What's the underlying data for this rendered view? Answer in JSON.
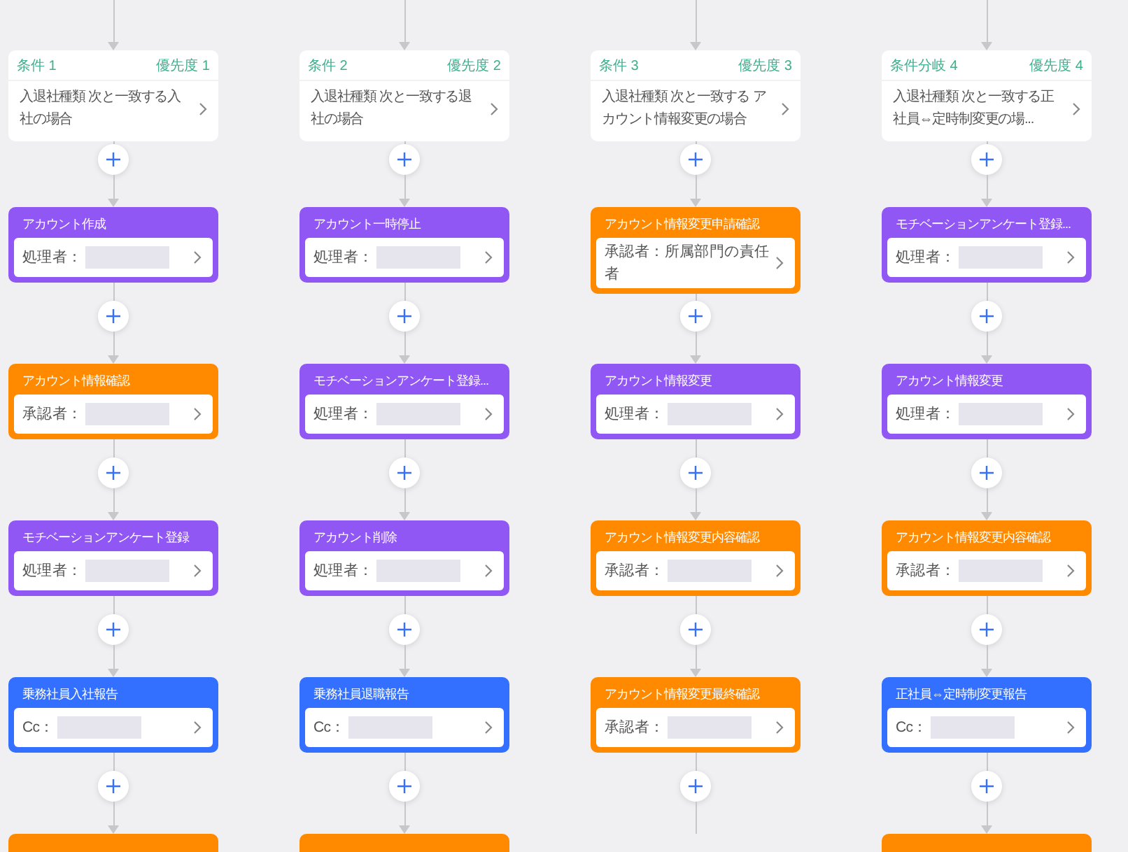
{
  "columns": [
    {
      "condition": {
        "label": "条件 1",
        "priority": "優先度 1",
        "text": "入退社種類 次と一致する入社の場合"
      },
      "steps": [
        {
          "kind": "process",
          "title": "アカウント作成",
          "role": "処理者：",
          "redacted": true
        },
        {
          "kind": "approval",
          "title": "アカウント情報確認",
          "role": "承認者：",
          "redacted": true
        },
        {
          "kind": "process",
          "title": "モチベーションアンケート登録",
          "role": "処理者：",
          "redacted": true
        },
        {
          "kind": "cc",
          "title": "乗務社員入社報告",
          "role": "Cc：",
          "redacted": true
        },
        {
          "kind": "approval"
        }
      ]
    },
    {
      "condition": {
        "label": "条件 2",
        "priority": "優先度 2",
        "text": "入退社種類 次と一致する退社の場合"
      },
      "steps": [
        {
          "kind": "process",
          "title": "アカウント一時停止",
          "role": "処理者：",
          "redacted": true
        },
        {
          "kind": "process",
          "title": "モチベーションアンケート登録...",
          "role": "処理者：",
          "redacted": true
        },
        {
          "kind": "process",
          "title": "アカウント削除",
          "role": "処理者：",
          "redacted": true
        },
        {
          "kind": "cc",
          "title": "乗務社員退職報告",
          "role": "Cc：",
          "redacted": true
        },
        {
          "kind": "approval"
        }
      ]
    },
    {
      "condition": {
        "label": "条件 3",
        "priority": "優先度 3",
        "text": "入退社種類 次と一致する アカウント情報変更の場合"
      },
      "steps": [
        {
          "kind": "approval",
          "title": "アカウント情報変更申請確認",
          "role": "承認者：所属部門の責任者",
          "redacted": false
        },
        {
          "kind": "process",
          "title": "アカウント情報変更",
          "role": "処理者：",
          "redacted": true
        },
        {
          "kind": "approval",
          "title": "アカウント情報変更内容確認",
          "role": "承認者：",
          "redacted": true
        },
        {
          "kind": "approval",
          "title": "アカウント情報変更最終確認",
          "role": "承認者：",
          "redacted": true
        }
      ]
    },
    {
      "condition": {
        "label": "条件分岐 4",
        "priority": "優先度 4",
        "text": "入退社種類 次と一致する正社員⇔定時制変更の場..."
      },
      "steps": [
        {
          "kind": "process",
          "title": "モチベーションアンケート登録...",
          "role": "処理者：",
          "redacted": true
        },
        {
          "kind": "process",
          "title": "アカウント情報変更",
          "role": "処理者：",
          "redacted": true
        },
        {
          "kind": "approval",
          "title": "アカウント情報変更内容確認",
          "role": "承認者：",
          "redacted": true
        },
        {
          "kind": "cc",
          "title": "正社員⇔定時制変更報告",
          "role": "Cc：",
          "redacted": true
        },
        {
          "kind": "approval"
        }
      ]
    }
  ]
}
